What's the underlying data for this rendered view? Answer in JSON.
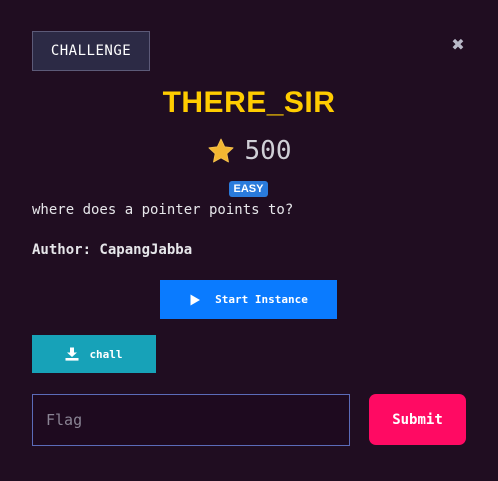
{
  "modal": {
    "tab_label": "CHALLENGE",
    "close_icon": "close-icon",
    "title": "THERE_SIR",
    "points": "500",
    "star_icon": "star-icon",
    "difficulty_badge": "EASY",
    "description": "where does a pointer points to?",
    "author": "Author: CapangJabba",
    "start_instance_label": "Start Instance",
    "file_download_label": "chall",
    "flag_placeholder": "Flag",
    "submit_label": "Submit"
  },
  "colors": {
    "background": "#200d21",
    "title": "#ffcc00",
    "start_button": "#0a7bff",
    "download_button": "#17a2b8",
    "submit_button": "#ff0a63",
    "badge": "#2a7bdc"
  }
}
